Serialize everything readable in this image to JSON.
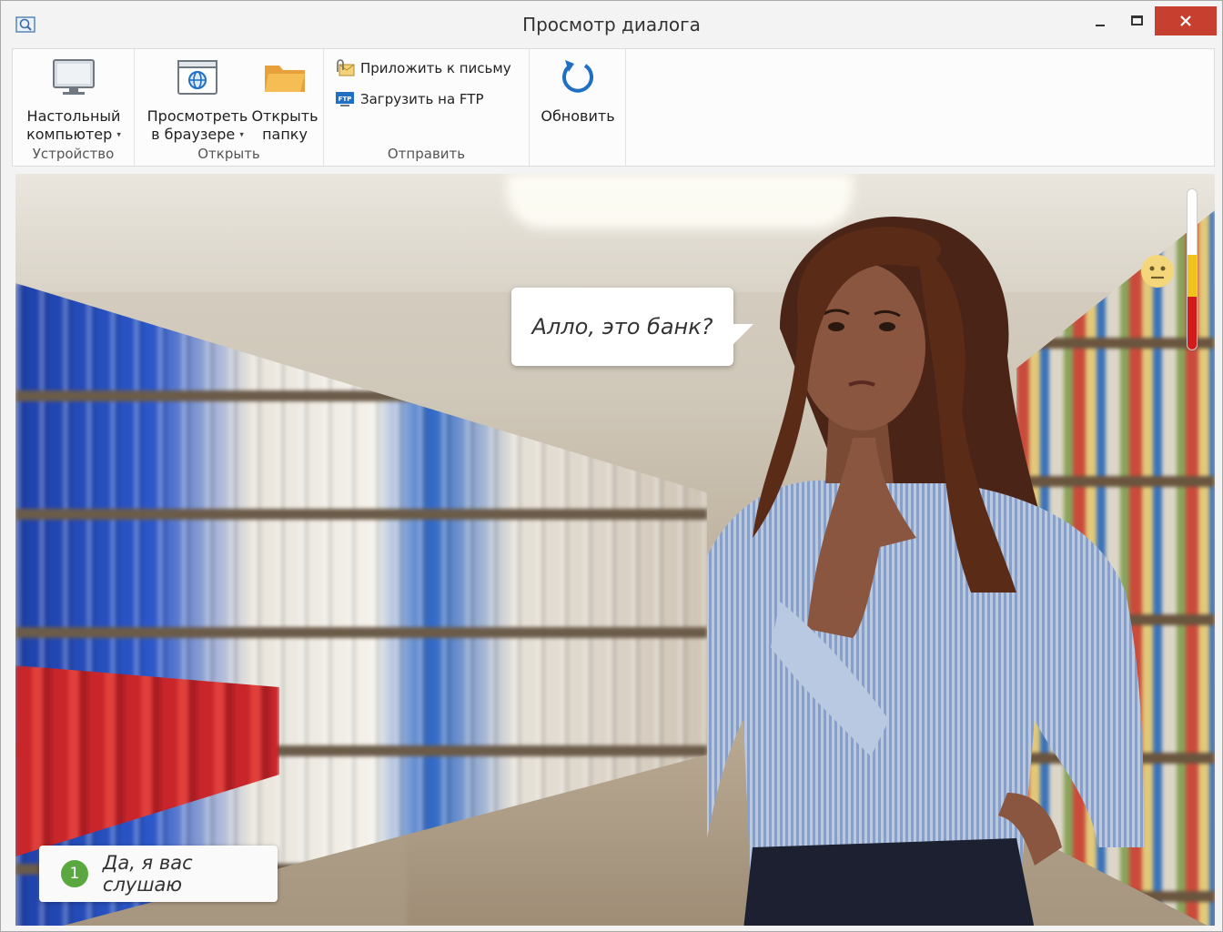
{
  "window": {
    "title": "Просмотр диалога"
  },
  "ribbon": {
    "groups": [
      {
        "label": "Устройство",
        "buttons": [
          {
            "line1": "Настольный",
            "line2": "компьютер",
            "has_dropdown": true,
            "icon": "monitor-icon"
          }
        ]
      },
      {
        "label": "Открыть",
        "buttons": [
          {
            "line1": "Просмотреть",
            "line2": "в браузере",
            "has_dropdown": true,
            "icon": "browser-icon"
          },
          {
            "line1": "Открыть",
            "line2": "папку",
            "has_dropdown": false,
            "icon": "folder-icon"
          }
        ]
      },
      {
        "label": "Отправить",
        "buttons": [
          {
            "label": "Приложить к письму",
            "icon": "mail-attach-icon"
          },
          {
            "label": "Загрузить на FTP",
            "icon": "ftp-icon"
          }
        ]
      },
      {
        "label": "",
        "buttons": [
          {
            "line1": "Обновить",
            "icon": "refresh-icon"
          }
        ]
      }
    ],
    "dropdown_glyph": "▾"
  },
  "scene": {
    "speech": "Алло, это банк?",
    "mood": {
      "face": "neutral-face-icon",
      "level": "yellow",
      "colors": {
        "yellow": "#f1c21b",
        "red": "#d31b1b"
      }
    },
    "answers": [
      {
        "number": "1",
        "text": "Да, я вас слушаю"
      }
    ]
  },
  "colors": {
    "close_button": "#c7402f",
    "refresh_blue": "#1f6fc2",
    "answer_badge": "#5aa83f"
  }
}
